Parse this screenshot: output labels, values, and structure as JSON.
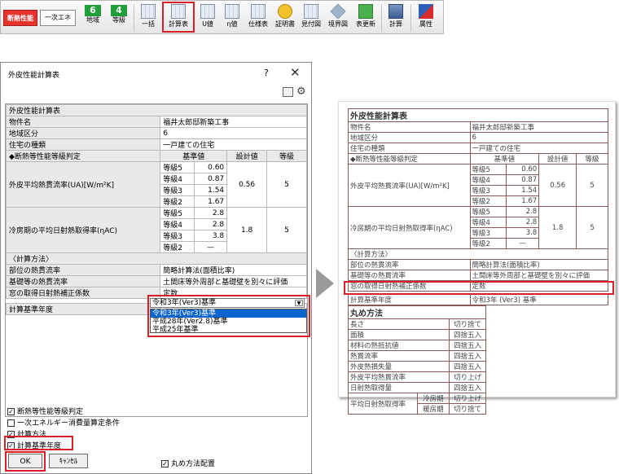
{
  "toolbar": {
    "heat_label": "断熱性能",
    "energy_label": "一次エネ",
    "region_num": "6",
    "region_label": "地域",
    "grade_num": "4",
    "grade_label": "等級",
    "bulk_label": "一括",
    "calc_sheet_label": "計算表",
    "u_label": "U値",
    "eta_label": "η値",
    "spec_label": "仕様表",
    "cert_label": "証明書",
    "estimate_label": "見付図",
    "boundary_label": "境界図",
    "table_new_label": "表更新",
    "calc_label": "計算",
    "attr_label": "属性"
  },
  "dialog": {
    "title": "外皮性能計算表",
    "help": "?",
    "close": "✕",
    "sheet": {
      "title": "外皮性能計算表",
      "property_label": "物件名",
      "property_value": "福井太郎邸新築工事",
      "region_label": "地域区分",
      "region_value": "6",
      "house_type_label": "住宅の種類",
      "house_type_value": "一戸建ての住宅",
      "grade_header": "◆断熱等性能等級判定",
      "std_header": "基準値",
      "design_header": "設計値",
      "grade_col_header": "等級",
      "ua_label": "外皮平均熱貫流率(UA)[W/m²K]",
      "ua_rows": [
        {
          "grade": "等級5",
          "value": "0.60"
        },
        {
          "grade": "等級4",
          "value": "0.87"
        },
        {
          "grade": "等級3",
          "value": "1.54"
        },
        {
          "grade": "等級2",
          "value": "1.67"
        }
      ],
      "ua_design": "0.56",
      "ua_grade": "5",
      "eta_label": "冷房期の平均日射熱取得率(ηAC)",
      "eta_rows": [
        {
          "grade": "等級5",
          "value": "2.8"
        },
        {
          "grade": "等級4",
          "value": "2.8"
        },
        {
          "grade": "等級3",
          "value": "3.8"
        },
        {
          "grade": "等級2",
          "value": "—"
        }
      ],
      "eta_design": "1.8",
      "eta_grade": "5",
      "method_header": "〈計算方法〉",
      "method_rows": [
        {
          "label": "部位の熱貫流率",
          "value": "簡略計算法(面積比率)"
        },
        {
          "label": "基礎等の熱貫流率",
          "value": "土間床等外周部と基礎壁を別々に評価"
        },
        {
          "label": "窓の取得日射熱補正係数",
          "value": "定数"
        }
      ],
      "year_label": "計算基準年度",
      "year_selected": "令和3年(Ver3)基準",
      "year_options": [
        "令和3年(Ver3)基準",
        "平成28年(Ver2.8)基準",
        "平成25年基準"
      ]
    },
    "checkboxes": {
      "grade_judge": "断熱等性能等級判定",
      "energy_cond": "一次エネルギー消費量算定条件",
      "method": "計算方法",
      "year": "計算基準年度",
      "round_layout": "丸め方法配置"
    },
    "ok_label": "OK",
    "cancel_label": "ｷｬﾝｾﾙ"
  },
  "preview": {
    "title": "外皮性能計算表",
    "property_label": "物件名",
    "property_value": "福井太郎邸新築工事",
    "region_label": "地域区分",
    "region_value": "6",
    "house_type_label": "住宅の種類",
    "house_type_value": "一戸建ての住宅",
    "grade_header": "◆断熱等性能等級判定",
    "std_header": "基準値",
    "design_header": "設計値",
    "grade_col_header": "等級",
    "ua_label": "外皮平均熱貫流率(UA)[W/m²K]",
    "eta_label": "冷房期の平均日射熱取得率(ηAC)",
    "method_header": "〈計算方法〉",
    "method_rows": [
      {
        "label": "部位の熱貫流率",
        "value": "簡略計算法(面積比率)"
      },
      {
        "label": "基礎等の熱貫流率",
        "value": "土間床等外周部と基礎壁を別々に評価"
      },
      {
        "label": "窓の取得日射熱補正係数",
        "value": "定数"
      }
    ],
    "year_label": "計算基準年度",
    "year_value": "令和3年 (Ver3) 基準"
  },
  "rounding": {
    "title": "丸め方法",
    "rows": [
      {
        "label": "長さ",
        "value": "切り捨て"
      },
      {
        "label": "面積",
        "value": "四捨五入"
      },
      {
        "label": "材料の熱抵抗値",
        "value": "四捨五入"
      },
      {
        "label": "熱貫流率",
        "value": "四捨五入"
      },
      {
        "label": "外皮熱損失量",
        "value": "四捨五入"
      },
      {
        "label": "外皮平均熱貫流率",
        "value": "切り上げ"
      },
      {
        "label": "日射熱取得量",
        "value": "四捨五入"
      }
    ],
    "last_label": "平均日射熱取得率",
    "cooling_label": "冷房期",
    "cooling_value": "切り上げ",
    "heating_label": "暖房期",
    "heating_value": "切り捨て"
  }
}
